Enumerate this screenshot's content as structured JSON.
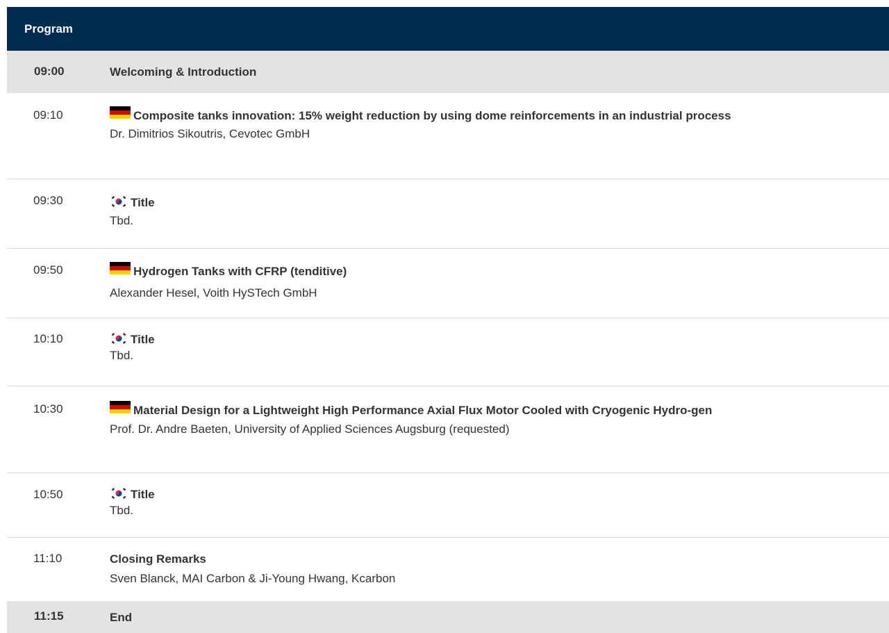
{
  "program": {
    "header": "Program",
    "rows": [
      {
        "time": "09:00",
        "title": "Welcoming & Introduction"
      },
      {
        "time": "09:10",
        "flag": "germany-flag-icon",
        "title": "Composite tanks innovation: 15% weight reduction by using dome reinforcements in an industrial process",
        "speaker": "Dr. Dimitrios Sikoutris, Cevotec GmbH"
      },
      {
        "time": "09:30",
        "flag": "south-korea-flag-icon",
        "title": "Title",
        "speaker": "Tbd."
      },
      {
        "time": "09:50",
        "flag": "germany-flag-icon",
        "title": "Hydrogen Tanks with CFRP (tenditive)",
        "speaker": "Alexander Hesel, Voith HySTech GmbH"
      },
      {
        "time": "10:10",
        "flag": "south-korea-flag-icon",
        "title": "Title",
        "speaker": "Tbd."
      },
      {
        "time": "10:30",
        "flag": "germany-flag-icon",
        "title": "Material Design for a Lightweight High Performance Axial Flux Motor Cooled with Cryogenic Hydro-gen",
        "speaker": "Prof. Dr. Andre Baeten, University of Applied Sciences Augsburg (requested)"
      },
      {
        "time": "10:50",
        "flag": "south-korea-flag-icon",
        "title": "Title",
        "speaker": "Tbd."
      },
      {
        "time": "11:10",
        "title": "Closing Remarks",
        "speaker": "Sven Blanck, MAI Carbon & Ji-Young Hwang, Kcarbon"
      },
      {
        "time": "11:15",
        "title": "End"
      }
    ]
  },
  "colors": {
    "header_bg": "#002b50",
    "header_text": "#ffffff",
    "highlight_row_bg": "#e3e3e3",
    "divider": "#d9d9d9",
    "text": "#333333"
  }
}
